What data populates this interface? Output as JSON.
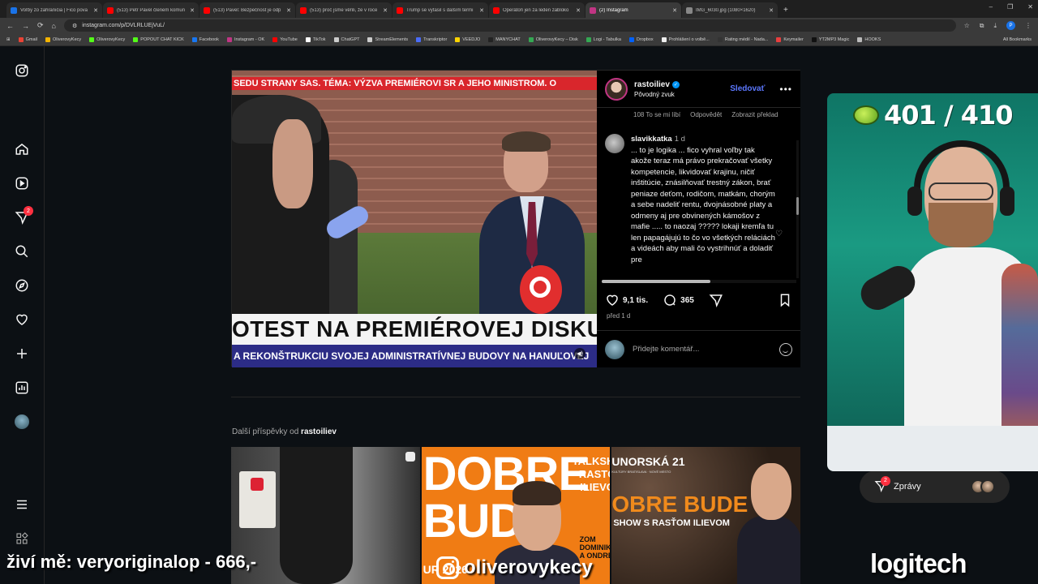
{
  "browser": {
    "tabs": [
      {
        "title": "Voľby zo zahraničia | Fico pova",
        "color": "#1a73e8",
        "active": false
      },
      {
        "title": "(513) Petr Pavel členem komun",
        "color": "#ff0000",
        "active": false
      },
      {
        "title": "(513) Pavel: Bezpečnost je odp",
        "color": "#ff0000",
        "active": false
      },
      {
        "title": "(513) proč jsme věřili, že v roce",
        "color": "#ff0000",
        "active": false
      },
      {
        "title": "Trump se vytasil s dalším termi",
        "color": "#ff0000",
        "active": false
      },
      {
        "title": "Operátoři jen za leden zabloko",
        "color": "#ff0000",
        "active": false
      },
      {
        "title": "(2) Instagram",
        "color": "#c13584",
        "active": true
      },
      {
        "title": "IMG_6030.jpg (1080×1620)",
        "color": "#888888",
        "active": false
      }
    ],
    "url": "instagram.com/p/DVLRLUEjVuL/",
    "profile_letter": "P",
    "bookmarks": [
      {
        "label": "Gmail",
        "color": "#ea4335"
      },
      {
        "label": "OliverovyKecy",
        "color": "#f4b400"
      },
      {
        "label": "OliverovyKecy",
        "color": "#53fc18"
      },
      {
        "label": "POPOUT CHAT KICK",
        "color": "#53fc18"
      },
      {
        "label": "Facebook",
        "color": "#1877f2"
      },
      {
        "label": "Instagram - OK",
        "color": "#c13584"
      },
      {
        "label": "YouTube",
        "color": "#ff0000"
      },
      {
        "label": "TikTok",
        "color": "#ffffff"
      },
      {
        "label": "ChatGPT",
        "color": "#cccccc"
      },
      {
        "label": "StreamElements",
        "color": "#cccccc"
      },
      {
        "label": "Transkriptor",
        "color": "#4a6cf7"
      },
      {
        "label": "VEEDJO",
        "color": "#ffd400"
      },
      {
        "label": "MANYCHAT",
        "color": "#222222"
      },
      {
        "label": "OliverovyKecy – Disk",
        "color": "#34a853"
      },
      {
        "label": "Logi - Tabulka",
        "color": "#34a853"
      },
      {
        "label": "Dropbox",
        "color": "#0061ff"
      },
      {
        "label": "Prohlášení o volbě...",
        "color": "#eeeeee"
      },
      {
        "label": "Rating médií - Nada...",
        "color": "#333333"
      },
      {
        "label": "Keymailer",
        "color": "#e83e3e"
      },
      {
        "label": "YT2MP3 Magic",
        "color": "#111111"
      },
      {
        "label": "HOOKS",
        "color": "#bbbbbb"
      }
    ],
    "all_bookmarks": "All Bookmarks"
  },
  "sidebar": {
    "notification_count": "2"
  },
  "video": {
    "ticker_top": "SEDU STRANY SAS. TÉMA: VÝZVA PREMIÉROVI SR A JEHO MINISTROM.  O",
    "lower_third": "OTEST NA PREMIÉROVEJ DISKUSII",
    "lower_sub": "A REKONŠTRUKCIU SVOJEJ ADMINISTRATÍVNEJ BUDOVY NA HANUĽOVEJ"
  },
  "post": {
    "username": "rastoiliev",
    "audio": "Pôvodný zvuk",
    "follow": "Sledovať",
    "likes_meta": "108 To se mi líbí",
    "reply": "Odpovědět",
    "translate": "Zobrazit překlad",
    "comment": {
      "user": "slavikkatka",
      "time": "1 d",
      "text": "... to je logika ... fico vyhral voľby tak akože teraz má právo prekračovať všetky kompetencie, likvidovať krajinu, ničiť inštitúcie, znásilňovať trestný zákon, brať peniaze deťom, rodičom, matkám, chorým a sebe nadeliť rentu, dvojnásobné platy a odmeny aj pre obvinených kámošov z mafie ..... to naozaj ????? lokaji kremľa tu len papagájujú to čo vo všetkých reláciách a videách aby mali čo vystrihnúť a doladiť pre"
    },
    "like_count": "9,1 tis.",
    "comment_count": "365",
    "date": "před 1 d",
    "add_comment_placeholder": "Přidejte komentář..."
  },
  "more_posts": {
    "prefix": "Další příspěvky od",
    "user": "rastoiliev",
    "thumb2_big": "DOBRE\nBUDE",
    "thumb2_small": "TALKSHO\nRASTŌ\nILIEVO",
    "thumb2_tag": "UR 2026",
    "thumb2_side": "ZOM\nDOMINIKA FIS\nA ONDREA BL",
    "thumb3_street": "UNORSKÁ 21",
    "thumb3_tiny": "KULTÚRY BRATISLAVA · NOVÉ MESTO",
    "thumb3_big": "OBRE BUDE",
    "thumb3_show": "SHOW S RASŤOM ILIEVOM"
  },
  "messages": {
    "label": "Zprávy",
    "count": "2"
  },
  "overlay": {
    "counter": "401 / 410",
    "donor_text": "živí mě: veryoriginalop - 666,-",
    "ig_handle": "oliverovykecy",
    "sponsor": "logitech"
  }
}
